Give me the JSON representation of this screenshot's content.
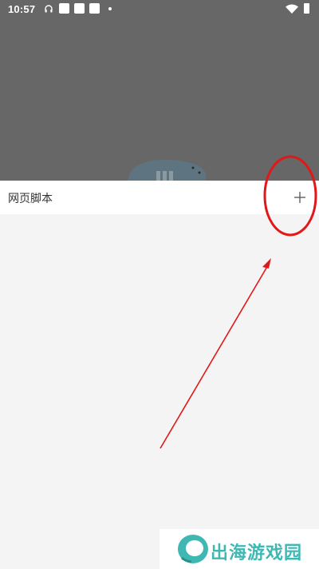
{
  "status_bar": {
    "time": "10:57",
    "icons": [
      "headset-icon",
      "app-notification-icon",
      "app-notification-icon",
      "app-notification-icon",
      "more-notifications-dot",
      "wifi-icon",
      "battery-icon"
    ]
  },
  "sheet": {
    "title": "网页脚本",
    "add_icon": "plus-icon"
  },
  "annotation": {
    "color": "#e21818",
    "shapes": [
      "circle-highlight",
      "arrow"
    ]
  },
  "watermark": {
    "text": "出海游戏园",
    "color": "#3fb8b4"
  },
  "colors": {
    "overlay": "#676767",
    "sheet_bg": "#ffffff",
    "page_bg": "#f4f4f4"
  }
}
